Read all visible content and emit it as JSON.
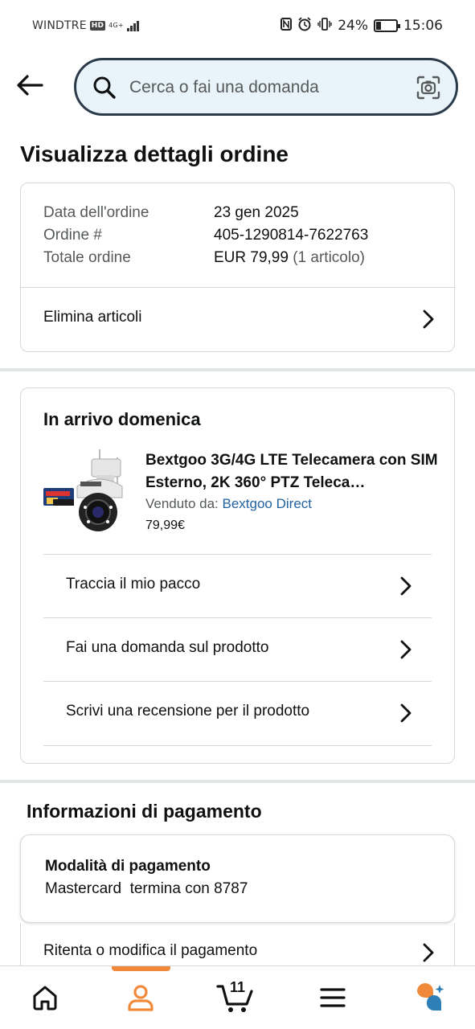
{
  "status_bar": {
    "carrier": "WINDTRE",
    "hd": "HD",
    "network": "4G+",
    "battery_text": "24%",
    "battery_level": 0.24,
    "time": "15:06"
  },
  "search": {
    "placeholder": "Cerca o fai una domanda"
  },
  "page": {
    "title": "Visualizza dettagli ordine"
  },
  "order_summary": {
    "date_label": "Data dell'ordine",
    "date_value": "23 gen 2025",
    "number_label": "Ordine #",
    "number_value": "405-1290814-7622763",
    "total_label": "Totale ordine",
    "total_value": "EUR 79,99",
    "total_count": "(1 articolo)",
    "delete_items_label": "Elimina articoli"
  },
  "shipment": {
    "status": "In arrivo domenica",
    "product_title": "Bextgoo 3G/4G LTE Telecamera con SIM Esterno, 2K 360° PTZ Teleca…",
    "seller_label": "Venduto da:",
    "seller_name": "Bextgoo Direct",
    "price": "79,99€",
    "actions": [
      {
        "label": "Traccia il mio pacco"
      },
      {
        "label": "Fai una domanda sul prodotto"
      },
      {
        "label": "Scrivi una recensione per il prodotto"
      }
    ]
  },
  "payment": {
    "heading": "Informazioni di pagamento",
    "method_label": "Modalità di pagamento",
    "method_value": "Mastercard  termina con 8787",
    "retry_label": "Ritenta o modifica il pagamento"
  },
  "bottom_nav": {
    "cart_count": "11",
    "active": "account"
  },
  "colors": {
    "accent_orange": "#f08a3a",
    "link_blue": "#2162a1",
    "search_bg": "#e8f3fa",
    "search_border": "#2b3b4a"
  }
}
